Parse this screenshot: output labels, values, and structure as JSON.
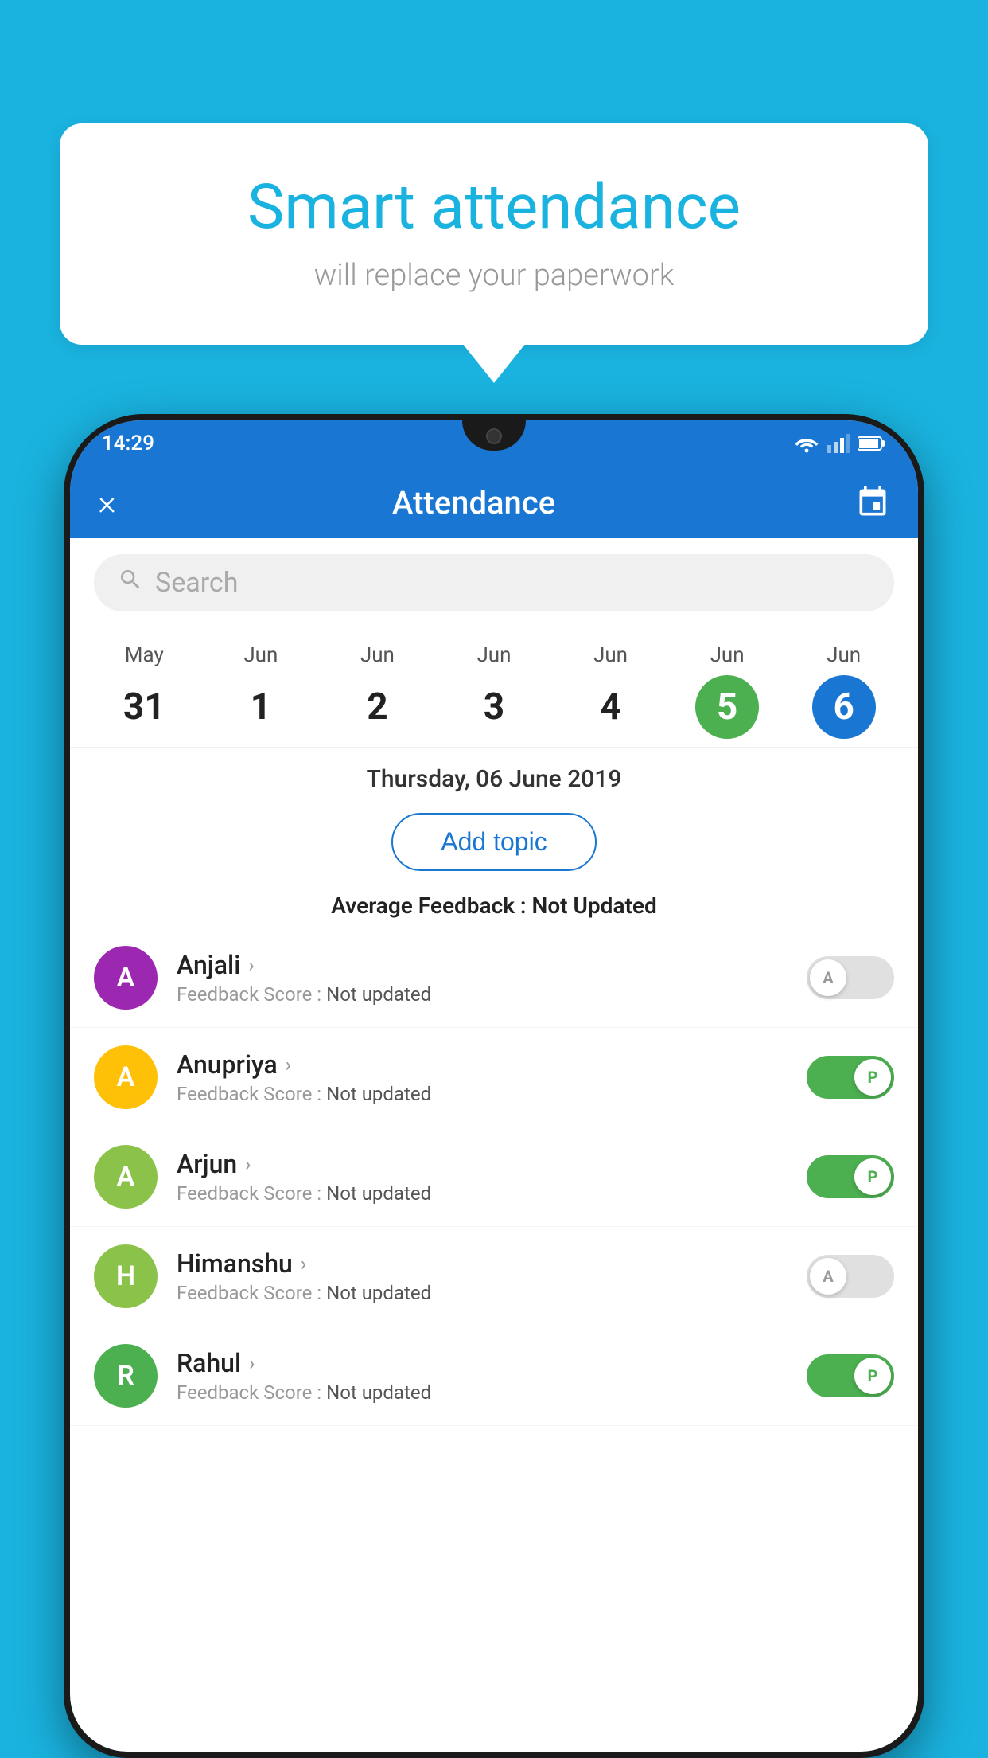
{
  "background_color": "#1ab3e0",
  "speech_bubble": {
    "title": "Smart attendance",
    "subtitle": "will replace your paperwork"
  },
  "phone": {
    "status_bar": {
      "time": "14:29"
    },
    "app_bar": {
      "title": "Attendance",
      "close_label": "×"
    },
    "search": {
      "placeholder": "Search"
    },
    "calendar": {
      "days": [
        {
          "month": "May",
          "date": "31",
          "style": "normal"
        },
        {
          "month": "Jun",
          "date": "1",
          "style": "normal"
        },
        {
          "month": "Jun",
          "date": "2",
          "style": "normal"
        },
        {
          "month": "Jun",
          "date": "3",
          "style": "normal"
        },
        {
          "month": "Jun",
          "date": "4",
          "style": "normal"
        },
        {
          "month": "Jun",
          "date": "5",
          "style": "today"
        },
        {
          "month": "Jun",
          "date": "6",
          "style": "selected"
        }
      ]
    },
    "selected_date": "Thursday, 06 June 2019",
    "add_topic_label": "Add topic",
    "avg_feedback_label": "Average Feedback :",
    "avg_feedback_value": "Not Updated",
    "students": [
      {
        "name": "Anjali",
        "avatar_letter": "A",
        "avatar_color": "#9c27b0",
        "feedback": "Not updated",
        "status": "absent"
      },
      {
        "name": "Anupriya",
        "avatar_letter": "A",
        "avatar_color": "#ffc107",
        "feedback": "Not updated",
        "status": "present"
      },
      {
        "name": "Arjun",
        "avatar_letter": "A",
        "avatar_color": "#8bc34a",
        "feedback": "Not updated",
        "status": "present"
      },
      {
        "name": "Himanshu",
        "avatar_letter": "H",
        "avatar_color": "#8bc34a",
        "feedback": "Not updated",
        "status": "absent"
      },
      {
        "name": "Rahul",
        "avatar_letter": "R",
        "avatar_color": "#4caf50",
        "feedback": "Not updated",
        "status": "present"
      }
    ],
    "feedback_label": "Feedback Score :"
  }
}
